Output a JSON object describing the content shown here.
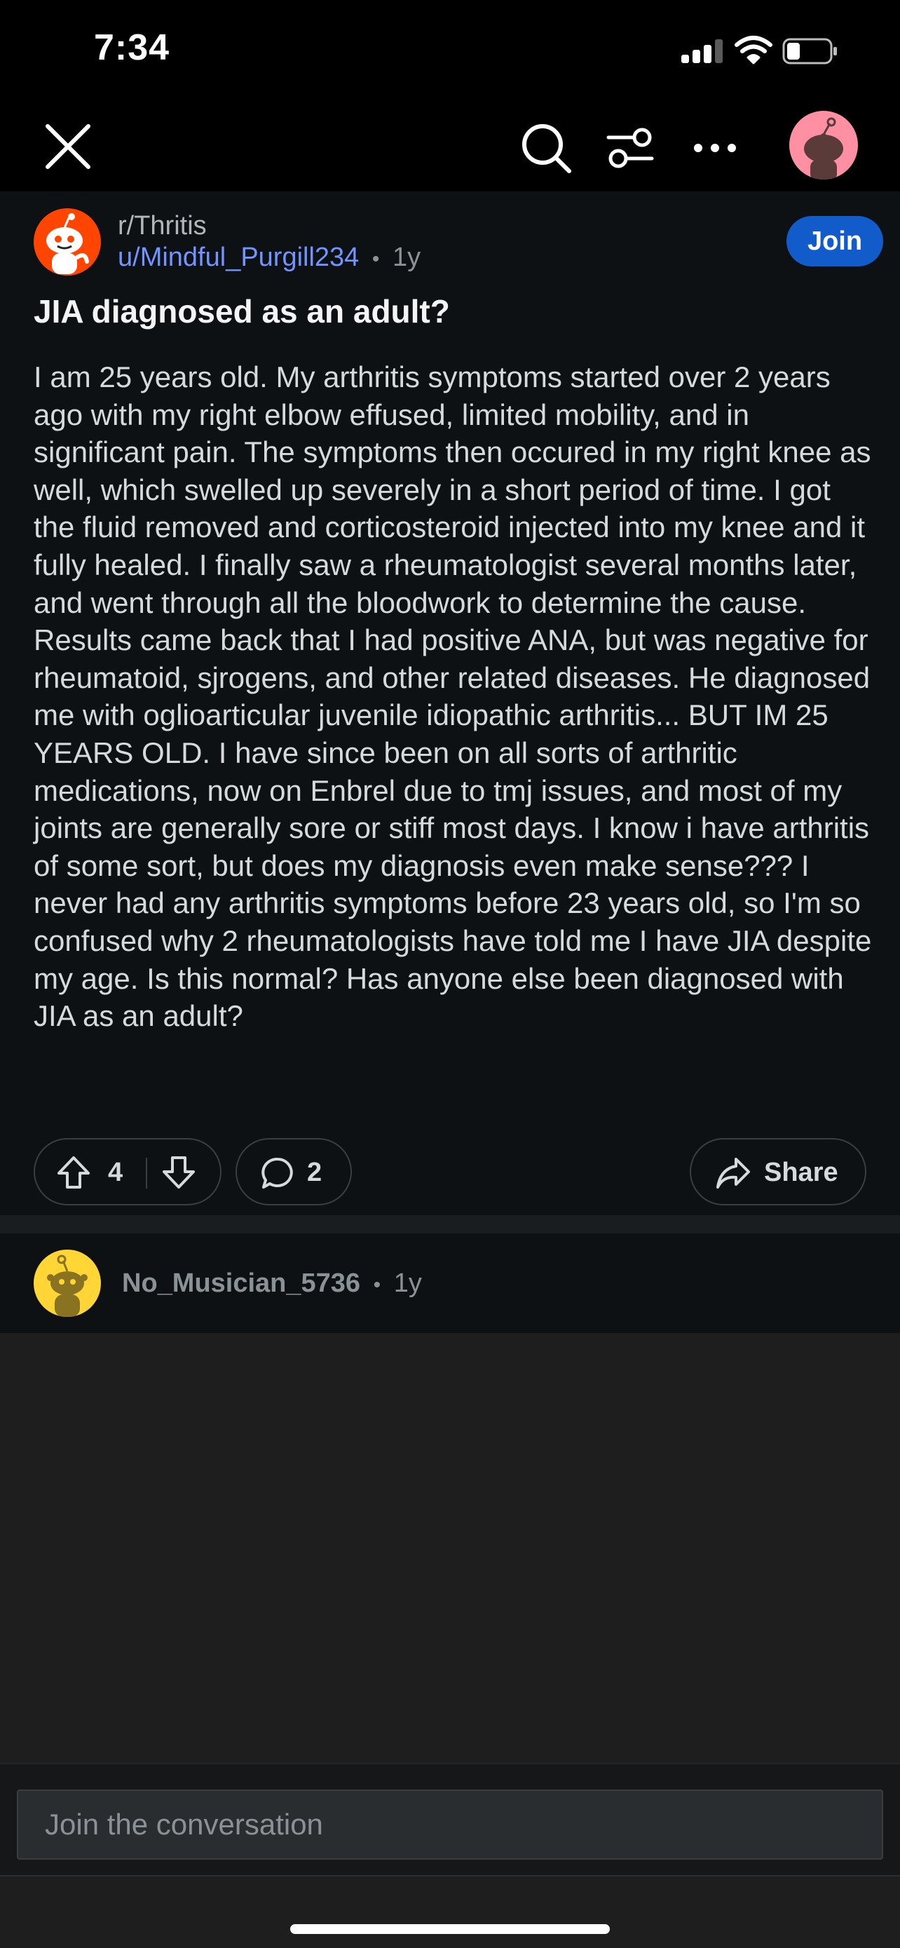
{
  "status_bar": {
    "time": "7:34",
    "signal_icon": "cellular-signal-icon",
    "wifi_icon": "wifi-icon",
    "battery_icon": "battery-icon"
  },
  "top_nav": {
    "close_icon": "close-icon",
    "search_icon": "search-icon",
    "filter_icon": "sort-options-icon",
    "more_icon": "more-options-icon",
    "avatar_icon": "user-avatar-icon"
  },
  "post": {
    "subreddit": "r/Thritis",
    "author": "u/Mindful_Purgill234",
    "separator": "•",
    "age": "1y",
    "join_label": "Join",
    "title": "JIA diagnosed as an adult?",
    "body": "I am 25 years old. My arthritis symptoms started over 2 years ago with my right elbow effused, limited mobility, and in significant pain. The symptoms then occured in my right knee as well, which swelled up severely in a short period of time. I got the fluid removed and corticosteroid injected into my knee and it fully healed. I finally saw a rheumatologist several months later, and went through all the bloodwork to determine the cause. Results came back that I had positive ANA, but was negative for rheumatoid, sjrogens, and other related diseases. He diagnosed me with oglioarticular juvenile idiopathic arthritis... BUT IM 25 YEARS OLD. I have since been on all sorts of arthritic medications, now on Enbrel due to tmj issues, and most of my joints are generally sore or stiff most days. I know i have arthritis of some sort, but does my diagnosis even make sense??? I never had any arthritis symptoms before 23 years old, so I'm so confused why 2 rheumatologists have told me I have JIA despite my age. Is this normal? Has anyone else been diagnosed with JIA as an adult?",
    "vote_count": "4",
    "comment_count": "2",
    "share_label": "Share"
  },
  "comment": {
    "author": "No_Musician_5736",
    "separator": "•",
    "age": "1y"
  },
  "composer": {
    "placeholder": "Join the conversation"
  },
  "colors": {
    "background": "#1e1e1e",
    "card": "#0e1113",
    "join_button": "#115bca",
    "username_link": "#7194ff",
    "subreddit_avatar": "#ff4500",
    "comment_avatar": "#ffd635",
    "user_avatar": "#ff8fa3"
  }
}
